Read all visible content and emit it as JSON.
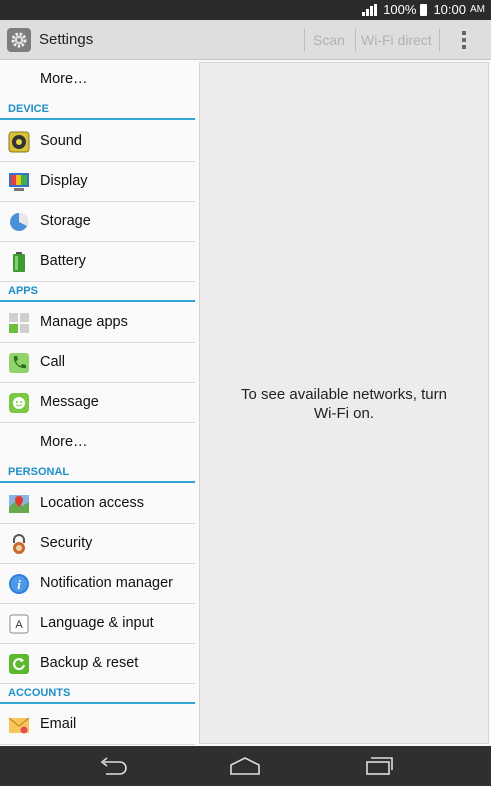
{
  "status_bar": {
    "battery_level": "100%",
    "time": "10:00",
    "ampm": "AM"
  },
  "action_bar": {
    "title": "Settings",
    "scan_label": "Scan",
    "wifi_direct_label": "Wi-Fi direct"
  },
  "settings_list": {
    "more_top": "More…",
    "device_header": "DEVICE",
    "sound": "Sound",
    "display": "Display",
    "storage": "Storage",
    "battery": "Battery",
    "apps_header": "APPS",
    "manage_apps": "Manage apps",
    "call": "Call",
    "message": "Message",
    "more_apps": "More…",
    "personal_header": "PERSONAL",
    "location_access": "Location access",
    "security": "Security",
    "notification_manager": "Notification manager",
    "language_input": "Language & input",
    "backup_reset": "Backup & reset",
    "accounts_header": "ACCOUNTS",
    "email": "Email"
  },
  "wifi_panel": {
    "message_line1": "To see available networks, turn",
    "message_line2": "Wi-Fi on."
  },
  "colors": {
    "accent": "#34a3d6",
    "header_text": "#1e90c8"
  }
}
